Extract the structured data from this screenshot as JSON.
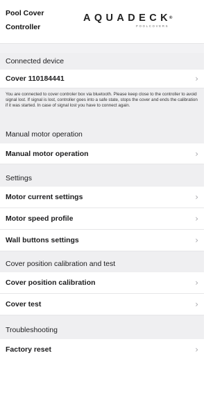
{
  "header": {
    "title": "Pool Cover Controller",
    "logo_main": "AQUADECK",
    "logo_mark": "®",
    "logo_sub": "POOLCOVERS"
  },
  "sections": {
    "connected": {
      "title": "Connected device",
      "device_label": "Cover 110184441",
      "info": "You are connected to cover controler box via bluetooth. Please keep close to the controller to avoid signal lost. If signal is lost, controller goes into a safe state, stops the cover and ends the calibration if it was started. In case of signal lost you have to connect again."
    },
    "manual": {
      "title": "Manual motor operation",
      "item": "Manual motor operation"
    },
    "settings": {
      "title": "Settings",
      "items": [
        "Motor current settings",
        "Motor speed profile",
        "Wall buttons settings"
      ]
    },
    "calibration": {
      "title": "Cover position calibration and test",
      "items": [
        "Cover position calibration",
        "Cover test"
      ]
    },
    "troubleshooting": {
      "title": "Troubleshooting",
      "items": [
        "Factory reset"
      ]
    }
  },
  "icons": {
    "chevron": "chevron-right-icon"
  },
  "colors": {
    "section_bg": "#efeff1",
    "row_bg": "#ffffff",
    "chevron": "#a8a8ac"
  }
}
